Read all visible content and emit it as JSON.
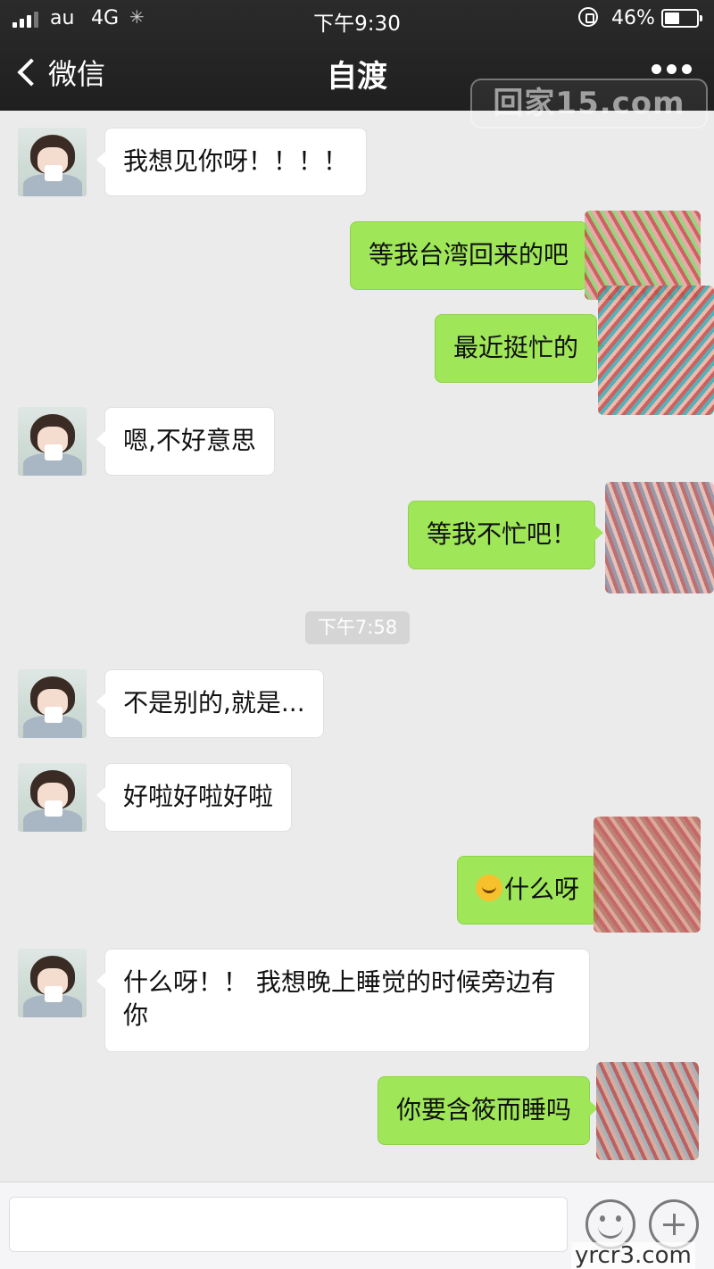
{
  "status_bar": {
    "carrier": "au",
    "network": "4G",
    "time": "下午9:30",
    "battery_percent": "46%",
    "battery_level": 0.46
  },
  "nav": {
    "back_label": "微信",
    "title": "自渡"
  },
  "watermarks": {
    "top": "回家15.com",
    "bottom": "yrcr3.com"
  },
  "messages": [
    {
      "side": "left",
      "text": "我想见你呀！！！！"
    },
    {
      "side": "right",
      "text": "等我台湾回来的吧"
    },
    {
      "side": "right",
      "text": "最近挺忙的"
    },
    {
      "side": "left",
      "text": "嗯,不好意思"
    },
    {
      "side": "right",
      "text": "等我不忙吧！"
    },
    {
      "side": "left",
      "text": "不是别的,就是..."
    },
    {
      "side": "left",
      "text": "好啦好啦好啦"
    },
    {
      "side": "right",
      "text": "什么呀",
      "emoji": "tears-of-joy-emoji"
    },
    {
      "side": "left",
      "text": "什么呀！！ 我想晚上睡觉的时候旁边有你"
    },
    {
      "side": "right",
      "text": "你要含筱而睡吗"
    }
  ],
  "timestamp": "下午7:58",
  "colors": {
    "header_bg": "#262626",
    "chat_bg": "#ebebeb",
    "sent_bubble": "#9fe659",
    "received_bubble": "#ffffff"
  }
}
